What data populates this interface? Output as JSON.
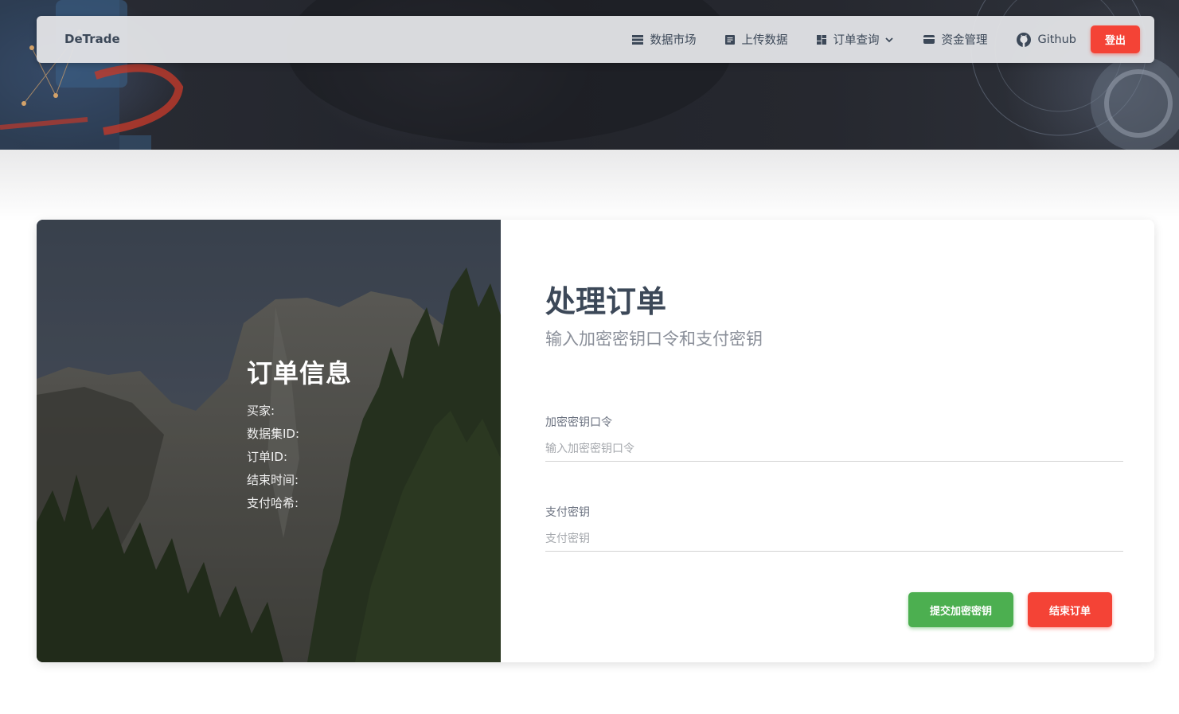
{
  "navbar": {
    "brand": "DeTrade",
    "items": [
      {
        "label": "数据市场",
        "icon": "storage-icon"
      },
      {
        "label": "上传数据",
        "icon": "document-icon"
      },
      {
        "label": "订单查询",
        "icon": "dashboard-icon",
        "has_dropdown": true
      },
      {
        "label": "资金管理",
        "icon": "credit-card-icon"
      },
      {
        "label": "Github",
        "icon": "github-icon"
      }
    ],
    "logout_label": "登出"
  },
  "order_info": {
    "title": "订单信息",
    "fields": [
      "买家:",
      "数据集ID:",
      "订单ID:",
      "结束时间:",
      "支付哈希:"
    ]
  },
  "form": {
    "title": "处理订单",
    "subtitle": "输入加密密钥口令和支付密钥",
    "key_label": "加密密钥口令",
    "key_placeholder": "输入加密密钥口令",
    "pay_label": "支付密钥",
    "pay_placeholder": "支付密钥",
    "submit_label": "提交加密密钥",
    "end_label": "结束订单"
  },
  "colors": {
    "primary_text": "#3c4858",
    "danger": "#f44336",
    "success": "#4caf50"
  }
}
